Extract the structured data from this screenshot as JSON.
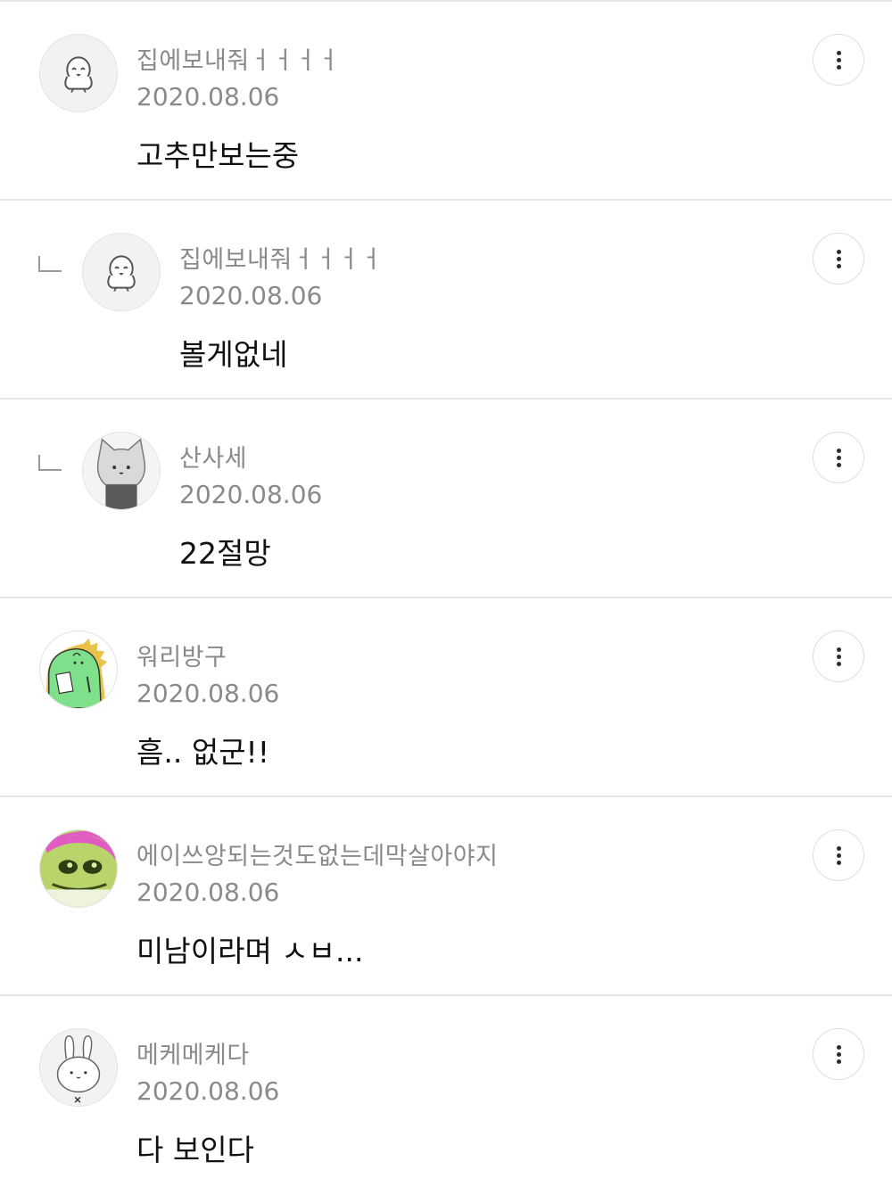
{
  "comments": [
    {
      "author": "집에보내줘ㅓㅓㅓㅓ",
      "date": "2020.08.06",
      "text": "고추만보는중",
      "is_reply": false,
      "avatar_icon": "round-bird-character-icon"
    },
    {
      "author": "집에보내줘ㅓㅓㅓㅓ",
      "date": "2020.08.06",
      "text": "볼게없네",
      "is_reply": true,
      "avatar_icon": "round-bird-character-icon"
    },
    {
      "author": "산사세",
      "date": "2020.08.06",
      "text": "22절망",
      "is_reply": true,
      "avatar_icon": "gray-cat-character-icon"
    },
    {
      "author": "워리방구",
      "date": "2020.08.06",
      "text": "흠.. 없군!!",
      "is_reply": false,
      "avatar_icon": "green-dinosaur-character-icon"
    },
    {
      "author": "에이쓰앙되는것도없는데막살아야지",
      "date": "2020.08.06",
      "text": "미남이라며 ㅅㅂ...",
      "is_reply": false,
      "avatar_icon": "green-frog-pink-hair-character-icon"
    },
    {
      "author": "메케메케다",
      "date": "2020.08.06",
      "text": "다 보인다",
      "is_reply": false,
      "avatar_icon": "white-bunny-character-icon"
    }
  ],
  "icons": {
    "more": "more-vertical-icon",
    "reply": "reply-arrow-icon"
  },
  "colors": {
    "author": "#8a8a8a",
    "date": "#8a8a8a",
    "body": "#111111",
    "divider": "#e6e6e6",
    "avatar_bg": "#f2f2f2",
    "dino_green": "#7fe08c",
    "frog_green": "#9fc24a",
    "frog_pink": "#e05cc2"
  }
}
